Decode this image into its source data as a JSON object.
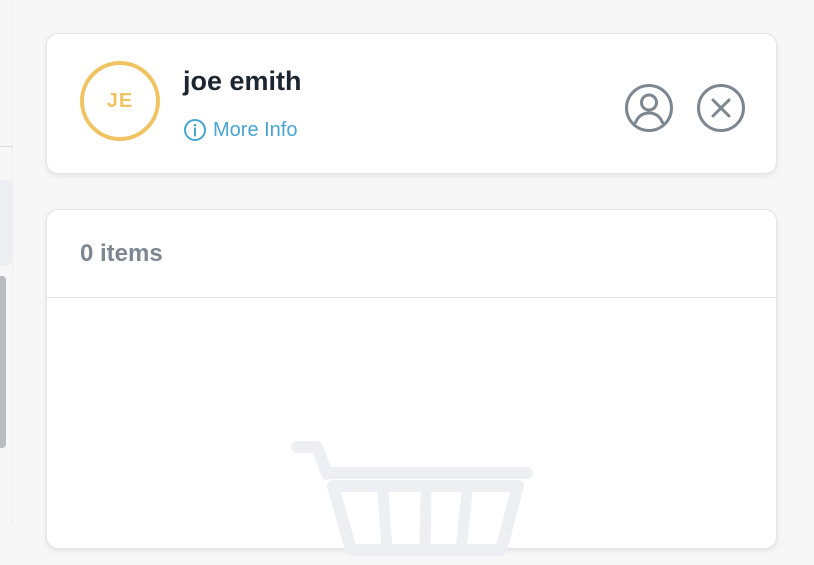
{
  "customer": {
    "initials": "JE",
    "name": "joe emith",
    "more_info_label": "More Info",
    "avatar_color": "#f0c462",
    "link_color": "#47a6d4"
  },
  "actions": {
    "profile_icon": "user-circle-icon",
    "close_icon": "close-circle-icon"
  },
  "cart": {
    "count_label": "0 items",
    "empty_icon": "shopping-cart-icon"
  }
}
